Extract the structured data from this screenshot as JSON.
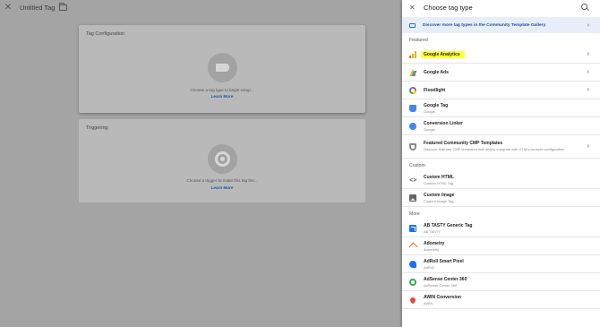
{
  "workspace": {
    "title": "Untitled Tag",
    "tag_config": {
      "title": "Tag Configuration",
      "hint": "Choose a tag type to begin setup...",
      "learn_more": "Learn More"
    },
    "triggering": {
      "title": "Triggering",
      "hint": "Choose a trigger to make this tag fire...",
      "learn_more": "Learn More"
    }
  },
  "panel": {
    "title": "Choose tag type",
    "banner": "Discover more tag types in the Community Template Gallery",
    "sections": {
      "featured": "Featured",
      "custom": "Custom",
      "more": "More"
    },
    "featured": [
      {
        "name": "Google Analytics",
        "icon": "google-analytics-icon",
        "chevron": true,
        "highlighted": true
      },
      {
        "name": "Google Ads",
        "icon": "google-ads-icon",
        "chevron": true
      },
      {
        "name": "Floodlight",
        "icon": "floodlight-icon",
        "chevron": true
      },
      {
        "name": "Google Tag",
        "sub": "Google",
        "icon": "google-tag-icon"
      },
      {
        "name": "Conversion Linker",
        "sub": "Google",
        "icon": "conversion-linker-icon"
      },
      {
        "name": "Featured Community CMP Templates",
        "desc": "Discover featured CMP templates that deeply integrate with GTM's consent configuration",
        "icon": "shield-icon",
        "chevron": true
      }
    ],
    "custom": [
      {
        "name": "Custom HTML",
        "sub": "Custom HTML Tag",
        "icon": "code-icon"
      },
      {
        "name": "Custom Image",
        "sub": "Custom Image Tag",
        "icon": "image-icon"
      }
    ],
    "more": [
      {
        "name": "AB TASTY Generic Tag",
        "sub": "AB TASTY",
        "icon": "ab-tasty-icon"
      },
      {
        "name": "Adometry",
        "sub": "Adometry",
        "icon": "adometry-icon"
      },
      {
        "name": "AdRoll Smart Pixel",
        "sub": "AdRoll",
        "icon": "adroll-icon"
      },
      {
        "name": "AdSense Center 360",
        "sub": "AdSense Center 360",
        "icon": "adsense-icon"
      },
      {
        "name": "AWIN Conversion",
        "sub": "AWIN",
        "icon": "awin-icon"
      }
    ]
  },
  "colors": {
    "accent": "#1a73e8",
    "highlight": "#ffff3b",
    "overlay": "#a4a4a4"
  }
}
